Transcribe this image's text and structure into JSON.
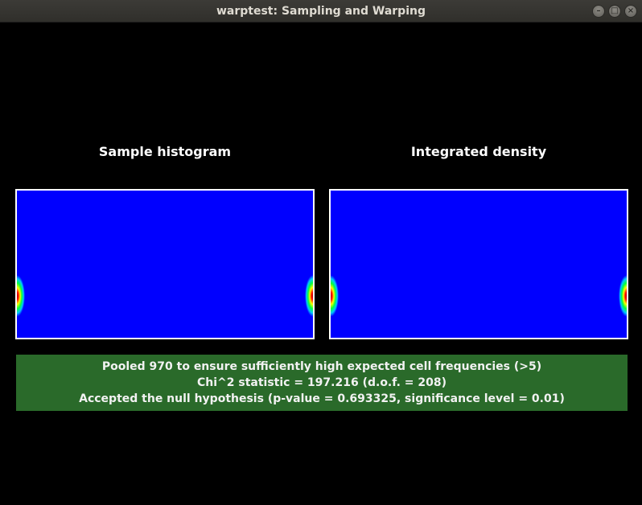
{
  "window": {
    "title": "warptest: Sampling and Warping",
    "buttons": {
      "minimize": "–",
      "maximize": "□",
      "close": "×"
    }
  },
  "panels": {
    "left_title": "Sample histogram",
    "right_title": "Integrated density"
  },
  "colormap": {
    "background": "#0000ff",
    "peak": "#ff0000",
    "mid": "#ffff00",
    "low": "#00ff40"
  },
  "status": {
    "color": "#2a6a2a",
    "line1": "Pooled 970 to ensure sufficiently high expected cell frequencies (>5)",
    "line2": "Chi^2 statistic = 197.216 (d.o.f. = 208)",
    "line3": "Accepted the null hypothesis (p-value = 0.693325, significance level = 0.01)"
  }
}
